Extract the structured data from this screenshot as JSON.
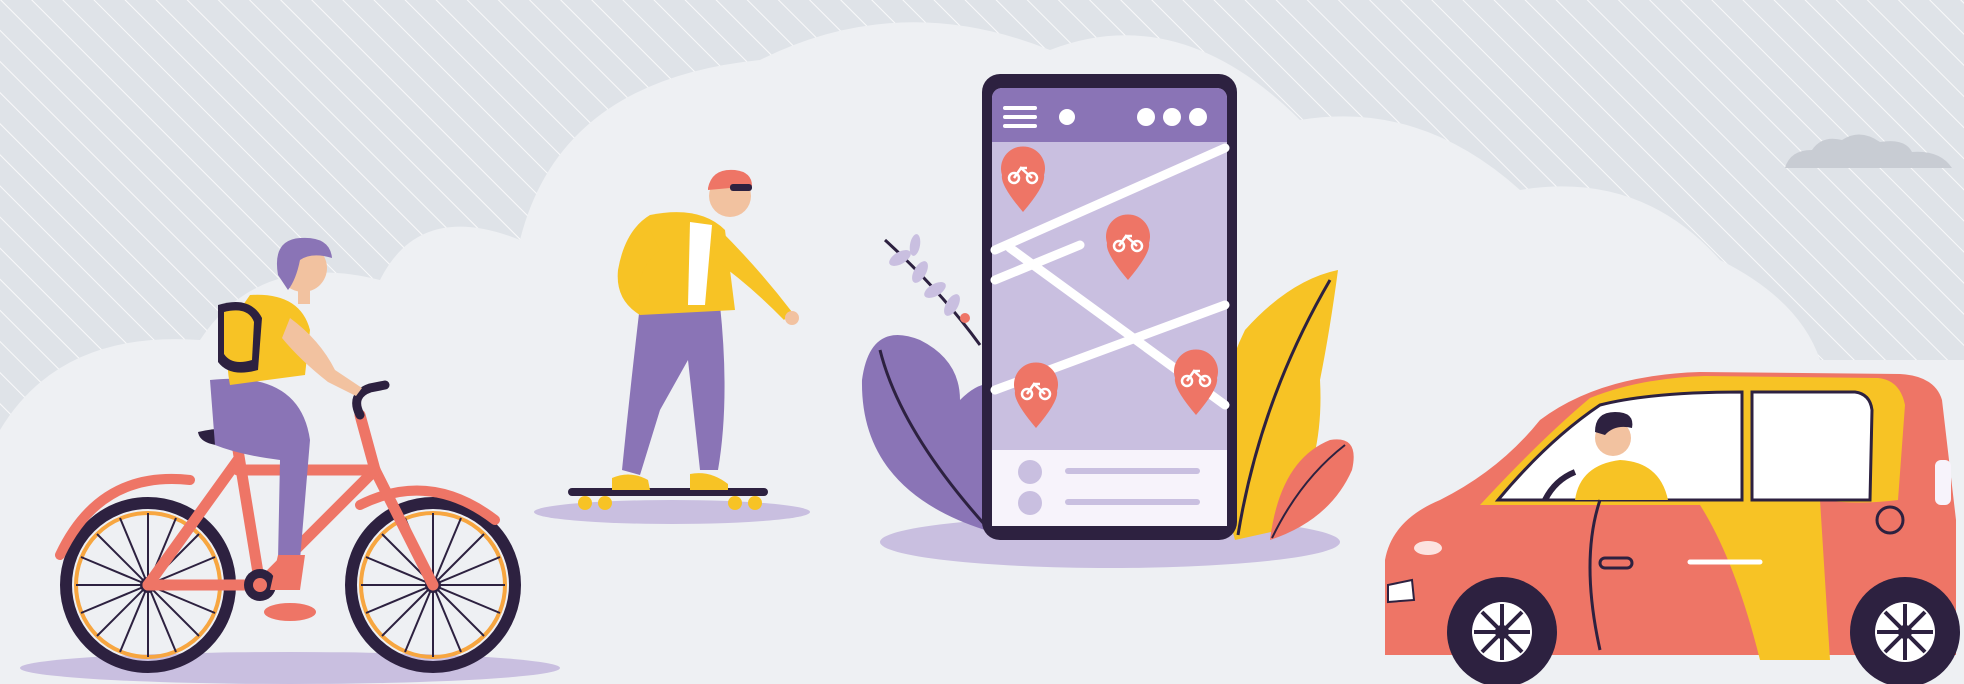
{
  "scene": {
    "colors": {
      "background": "#dfe3e8",
      "stripes": "#ffffff",
      "cloud": "#eef0f3",
      "purple": "#8a74b6",
      "purple_light": "#c9bfe0",
      "yellow": "#f7c325",
      "coral": "#ee7566",
      "dark": "#2d2140",
      "skin": "#f2c2a0",
      "white": "#ffffff"
    },
    "phone_app": {
      "pins": [
        {
          "icon": "bicycle-icon"
        },
        {
          "icon": "bicycle-icon"
        },
        {
          "icon": "bicycle-icon"
        },
        {
          "icon": "bicycle-icon"
        }
      ],
      "header_icons": [
        "menu-icon",
        "dot-icon",
        "more-icon"
      ]
    }
  }
}
